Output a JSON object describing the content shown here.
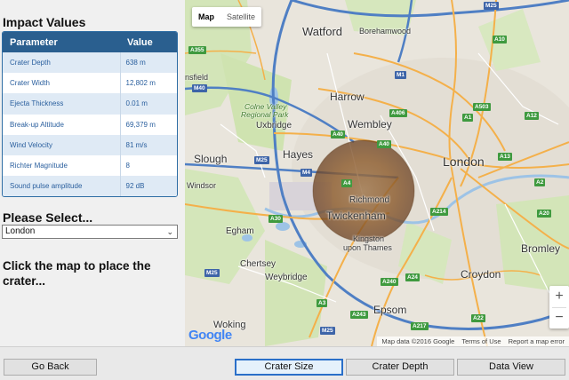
{
  "impact": {
    "title": "Impact Values",
    "headers": {
      "param": "Parameter",
      "value": "Value"
    },
    "rows": [
      {
        "param": "Crater Depth",
        "value": "638 m"
      },
      {
        "param": "Crater Width",
        "value": "12,802 m"
      },
      {
        "param": "Ejecta Thickness",
        "value": "0.01 m"
      },
      {
        "param": "Break-up Altitude",
        "value": "69,379 m"
      },
      {
        "param": "Wind Velocity",
        "value": "81 m/s"
      },
      {
        "param": "Richter Magnitude",
        "value": "8"
      },
      {
        "param": "Sound pulse amplitude",
        "value": "92 dB"
      }
    ]
  },
  "select": {
    "title": "Please Select...",
    "value": "London"
  },
  "instruction": "Click the map to place the crater...",
  "map": {
    "type_map": "Map",
    "type_satellite": "Satellite",
    "zoom_in": "+",
    "zoom_out": "−",
    "logo": "Google",
    "attribution": {
      "data": "Map data ©2016 Google",
      "terms": "Terms of Use",
      "report": "Report a map error"
    },
    "places": {
      "watford": "Watford",
      "borehamwood": "Borehamwood",
      "harrow": "Harrow",
      "wembley": "Wembley",
      "colne": "Colne Valley",
      "regional": "Regional Park",
      "uxbridge": "Uxbridge",
      "hayes": "Hayes",
      "slough": "Slough",
      "windsor": "Windsor",
      "london": "London",
      "richmond": "Richmond",
      "twickenham": "Twickenham",
      "kingston": "Kingston",
      "upon": "upon Thames",
      "egham": "Egham",
      "chertsey": "Chertsey",
      "weybridge": "Weybridge",
      "croydon": "Croydon",
      "bromley": "Bromley",
      "epsom": "Epsom",
      "woking": "Woking",
      "nsfield": "nsfield"
    },
    "roads": {
      "m25a": "M25",
      "a10": "A10",
      "a355": "A355",
      "m40": "M40",
      "m1": "M1",
      "a406": "A406",
      "a503": "A503",
      "a12": "A12",
      "a1": "A1",
      "a40": "A40",
      "a40b": "A40",
      "m25b": "M25",
      "m4": "M4",
      "a4": "A4",
      "a13": "A13",
      "a2": "A2",
      "a30": "A30",
      "a214": "A214",
      "a20": "A20",
      "a24": "A24",
      "m25c": "M25",
      "a240": "A240",
      "a3": "A3",
      "a243": "A243",
      "a217": "A217",
      "a22": "A22",
      "m25d": "M25"
    }
  },
  "buttons": {
    "back": "Go Back",
    "size": "Crater Size",
    "depth": "Crater Depth",
    "view": "Data View"
  },
  "colors": {
    "header": "#2a5f8f",
    "crater": "#8b5a2b",
    "focus": "#2a6fc9"
  }
}
